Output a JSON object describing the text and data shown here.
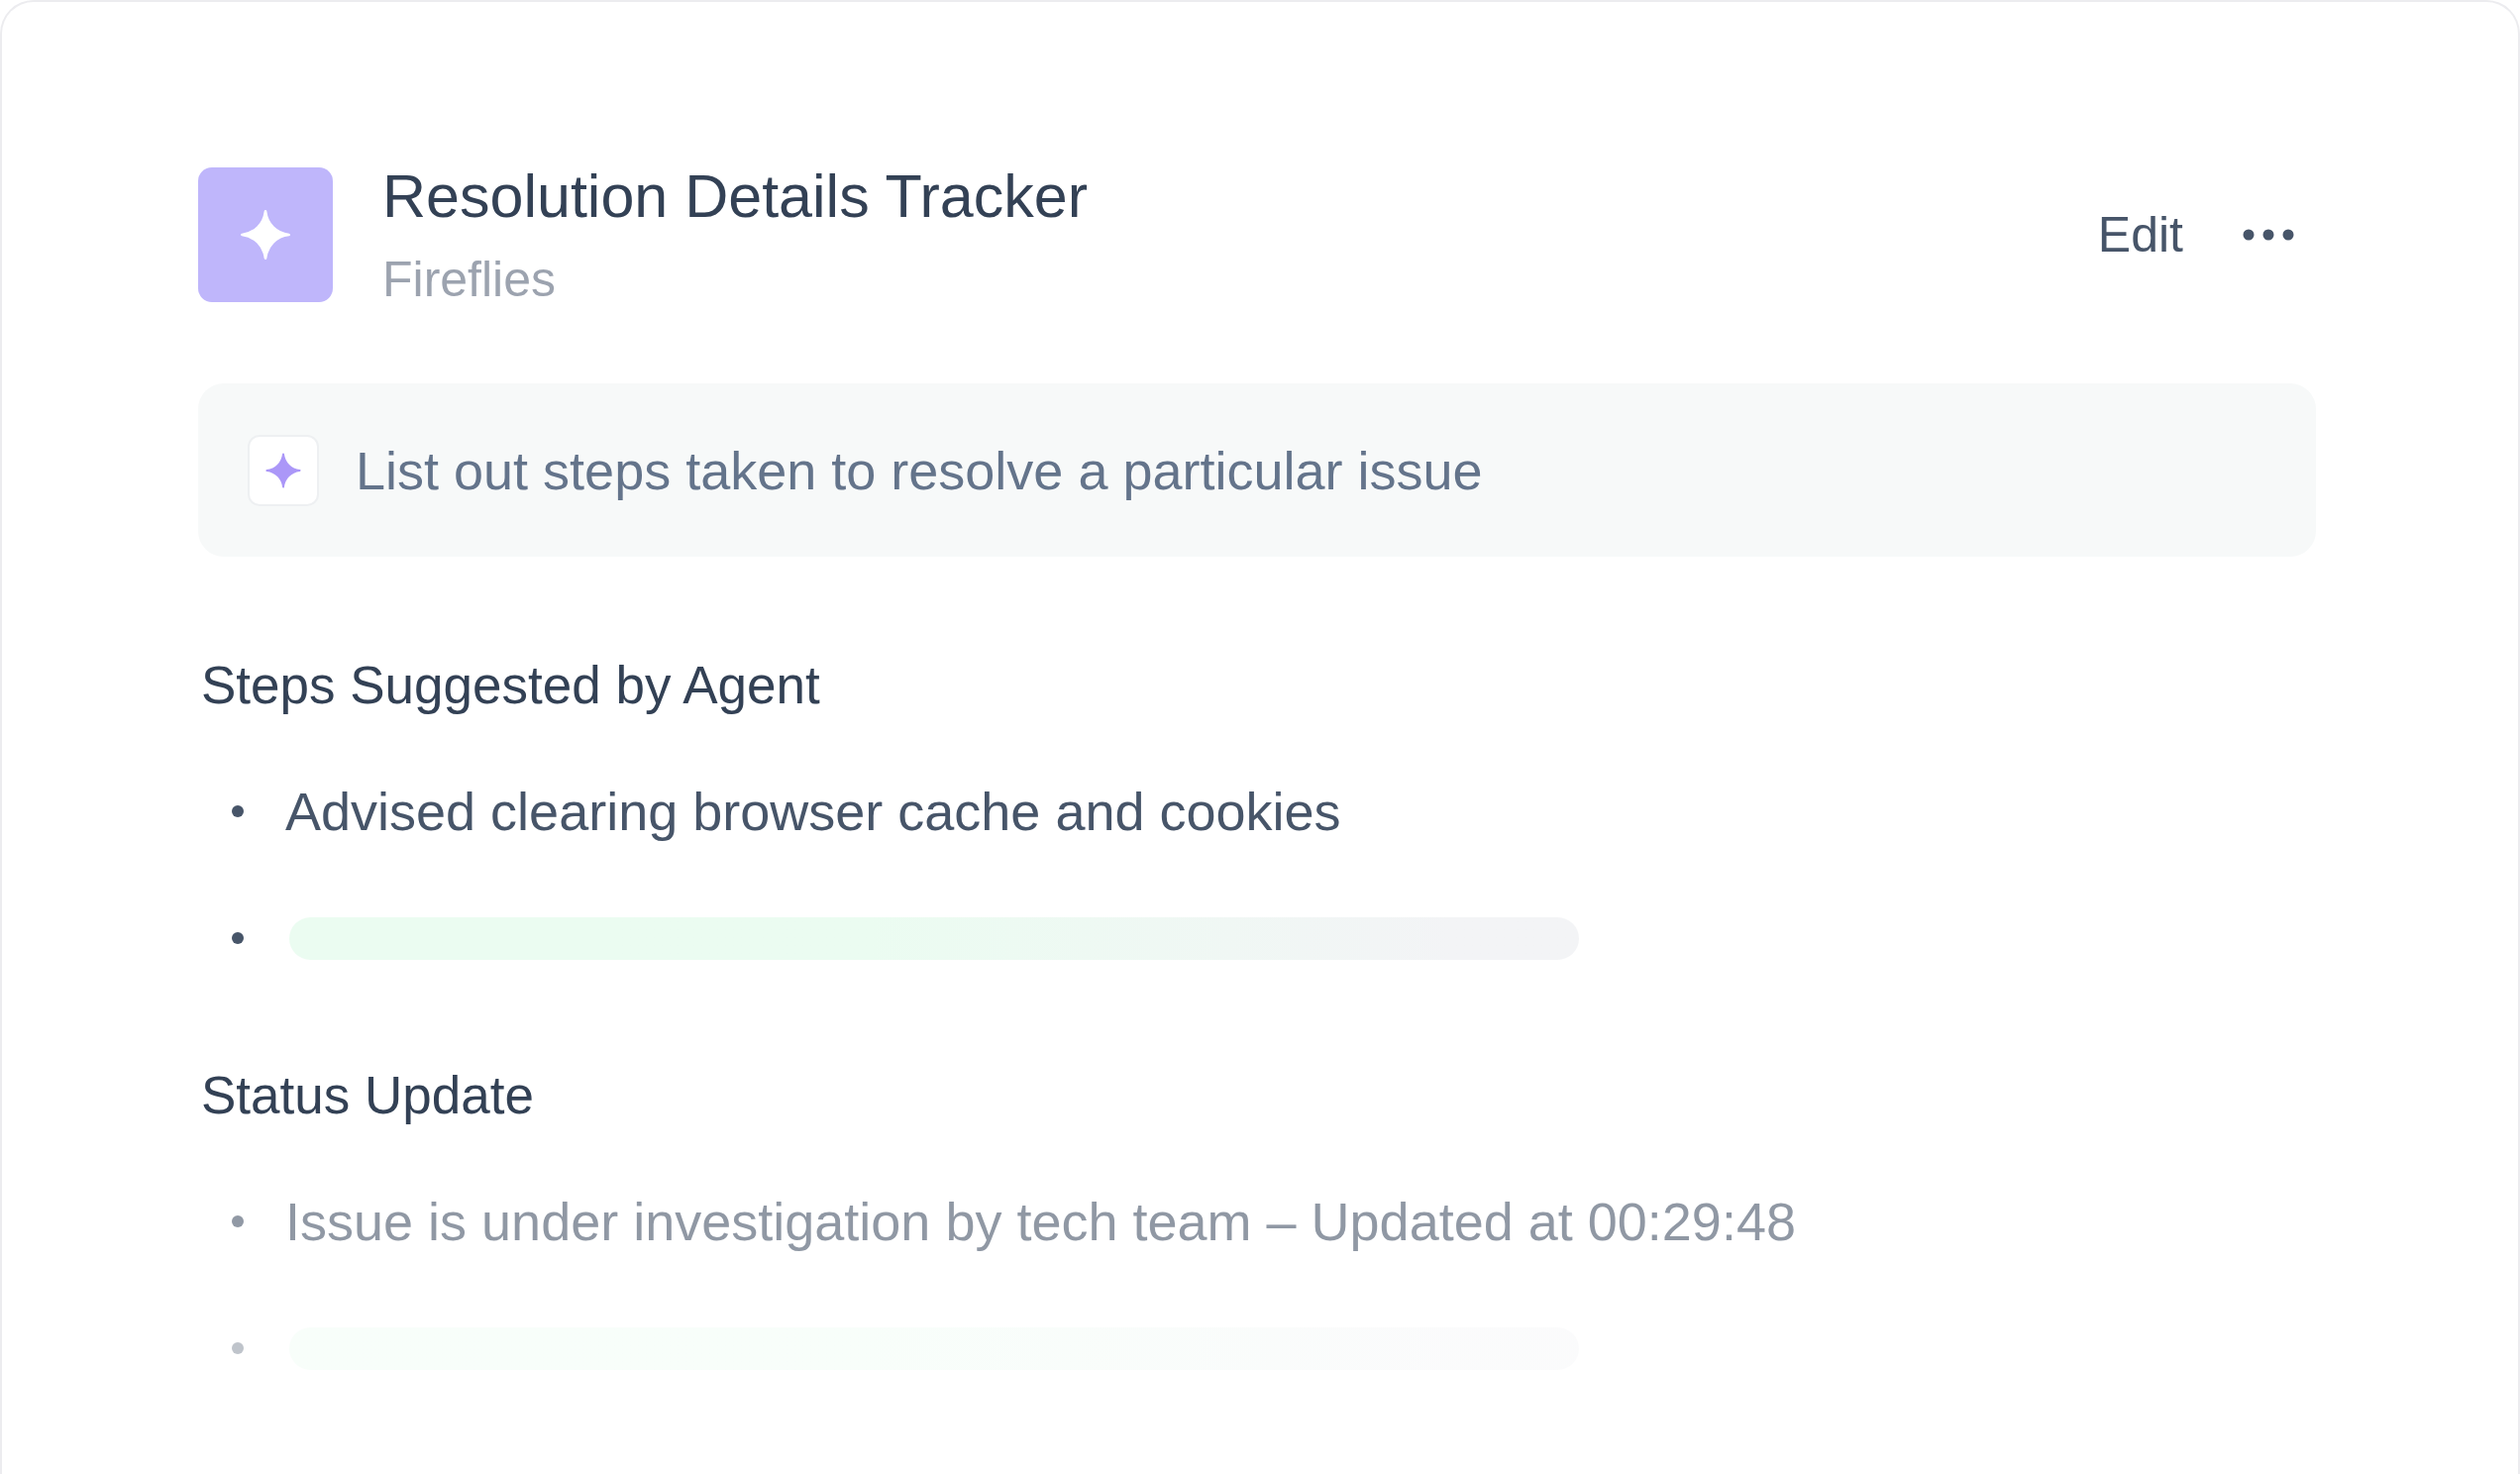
{
  "header": {
    "title": "Resolution Details Tracker",
    "subtitle": "Fireflies",
    "edit_label": "Edit"
  },
  "prompt": {
    "text": "List out steps taken to resolve a particular issue"
  },
  "sections": [
    {
      "heading": "Steps Suggested by Agent",
      "dimmed": false,
      "items": [
        {
          "kind": "text",
          "text": "Advised clearing browser cache and cookies"
        },
        {
          "kind": "skeleton"
        }
      ]
    },
    {
      "heading": "Status Update",
      "dimmed": true,
      "items": [
        {
          "kind": "text",
          "text": "Issue is under investigation by tech team – Updated at 00:29:48"
        },
        {
          "kind": "skeleton"
        }
      ]
    }
  ]
}
